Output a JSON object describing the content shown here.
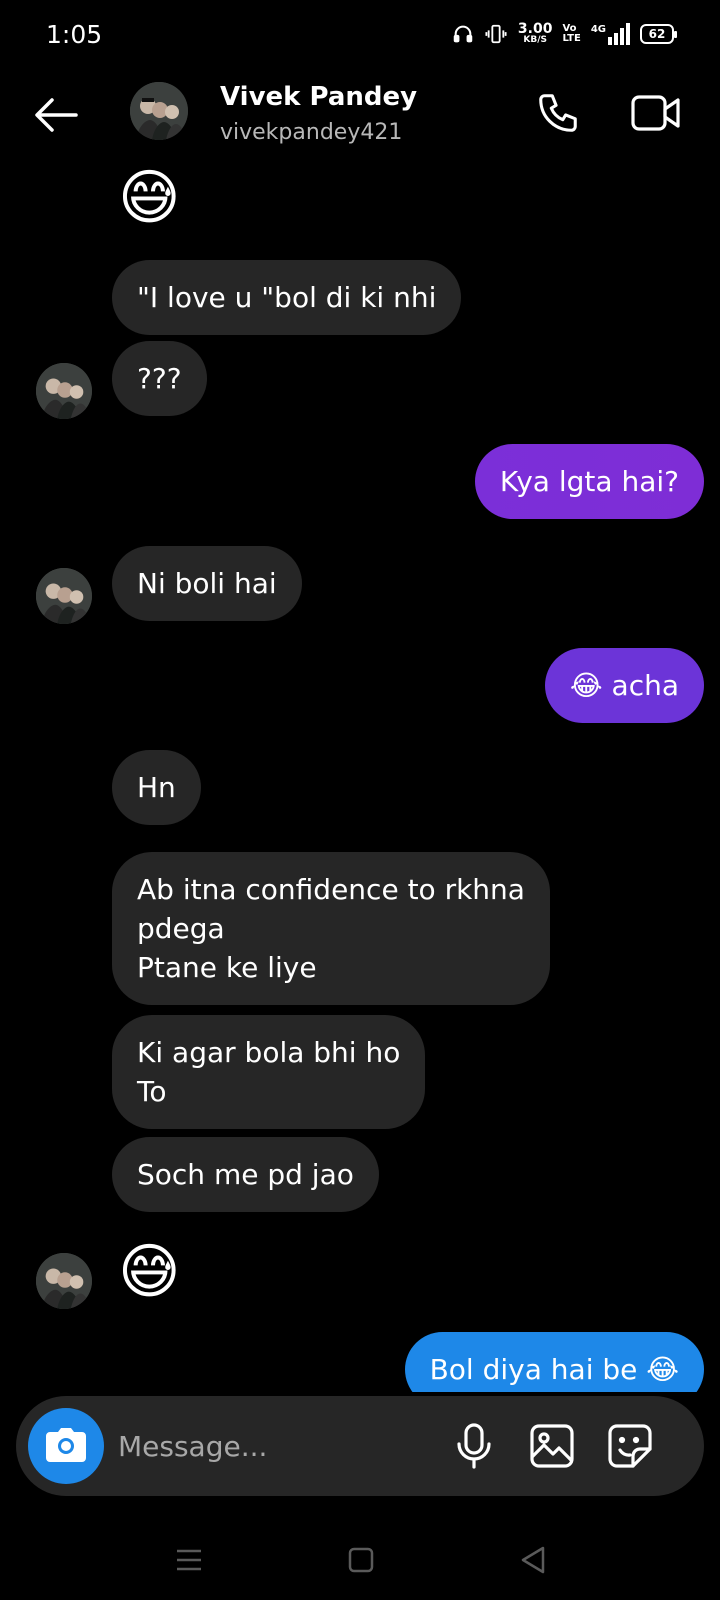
{
  "status_bar": {
    "time": "1:05",
    "net_speed_value": "3.00",
    "net_speed_unit": "KB/S",
    "volte_top": "Vo",
    "volte_bottom": "LTE",
    "network_type": "4G",
    "battery": "62"
  },
  "header": {
    "contact_name": "Vivek Pandey",
    "contact_username": "vivekpandey421"
  },
  "messages": [
    {
      "from": "them",
      "kind": "emoji",
      "text": "😅"
    },
    {
      "from": "them",
      "kind": "text",
      "text": "\"I love u \"bol di ki nhi"
    },
    {
      "from": "them",
      "kind": "text",
      "text": "???"
    },
    {
      "from": "me",
      "kind": "text",
      "text": "Kya lgta hai?"
    },
    {
      "from": "them",
      "kind": "text",
      "text": "Ni boli hai"
    },
    {
      "from": "me",
      "kind": "text",
      "text": "😂 acha"
    },
    {
      "from": "them",
      "kind": "text",
      "text": "Hn"
    },
    {
      "from": "them",
      "kind": "text",
      "text": "Ab itna confidence to rkhna\npdega\nPtane ke liye"
    },
    {
      "from": "them",
      "kind": "text",
      "text": "Ki agar bola bhi ho\nTo"
    },
    {
      "from": "them",
      "kind": "text",
      "text": "Soch me pd jao"
    },
    {
      "from": "them",
      "kind": "emoji",
      "text": "😅"
    },
    {
      "from": "me",
      "kind": "text",
      "text": "Bol diya hai be 😂"
    }
  ],
  "composer": {
    "placeholder": "Message..."
  },
  "icons": {
    "back": "back-arrow-icon",
    "call": "phone-icon",
    "video": "video-camera-icon",
    "camera": "camera-icon",
    "mic": "microphone-icon",
    "gallery": "gallery-icon",
    "sticker": "sticker-icon"
  },
  "colors": {
    "background": "#000000",
    "incoming_bubble": "#262626",
    "outgoing_purple": "#7b2fd8",
    "outgoing_blue": "#1e88e8",
    "camera_button": "#1e88e8"
  }
}
